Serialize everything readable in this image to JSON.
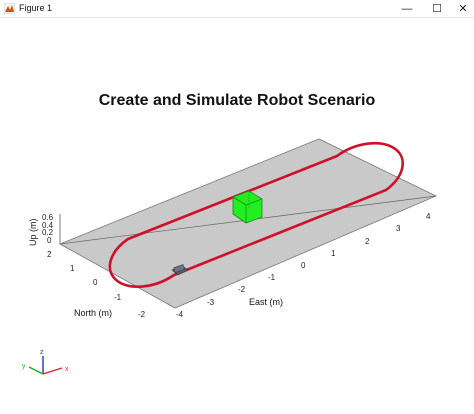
{
  "window": {
    "title": "Figure 1",
    "minimize_glyph": "—",
    "maximize_glyph": "☐",
    "close_glyph": "✕"
  },
  "plot": {
    "title": "Create and Simulate Robot Scenario",
    "xlabel": "East (m)",
    "ylabel": "North (m)",
    "zlabel": "Up (m)",
    "x_ticks": [
      "-4",
      "-3",
      "-2",
      "-1",
      "0",
      "1",
      "2",
      "3",
      "4"
    ],
    "y_ticks": [
      "2",
      "1",
      "0",
      "-1",
      "-2"
    ],
    "z_ticks": [
      "0.6",
      "0.4",
      "0.2",
      "0"
    ],
    "colors": {
      "ground": "#c9c9c9",
      "trajectory": "#d0102a",
      "box_face": "#22ee22",
      "box_edge": "#138a13",
      "robot": "#5a5a70"
    }
  },
  "triad": {
    "x_label": "x",
    "y_label": "y",
    "z_label": "z",
    "x_color": "#e0202a",
    "y_color": "#20b020",
    "z_color": "#2233cc"
  }
}
